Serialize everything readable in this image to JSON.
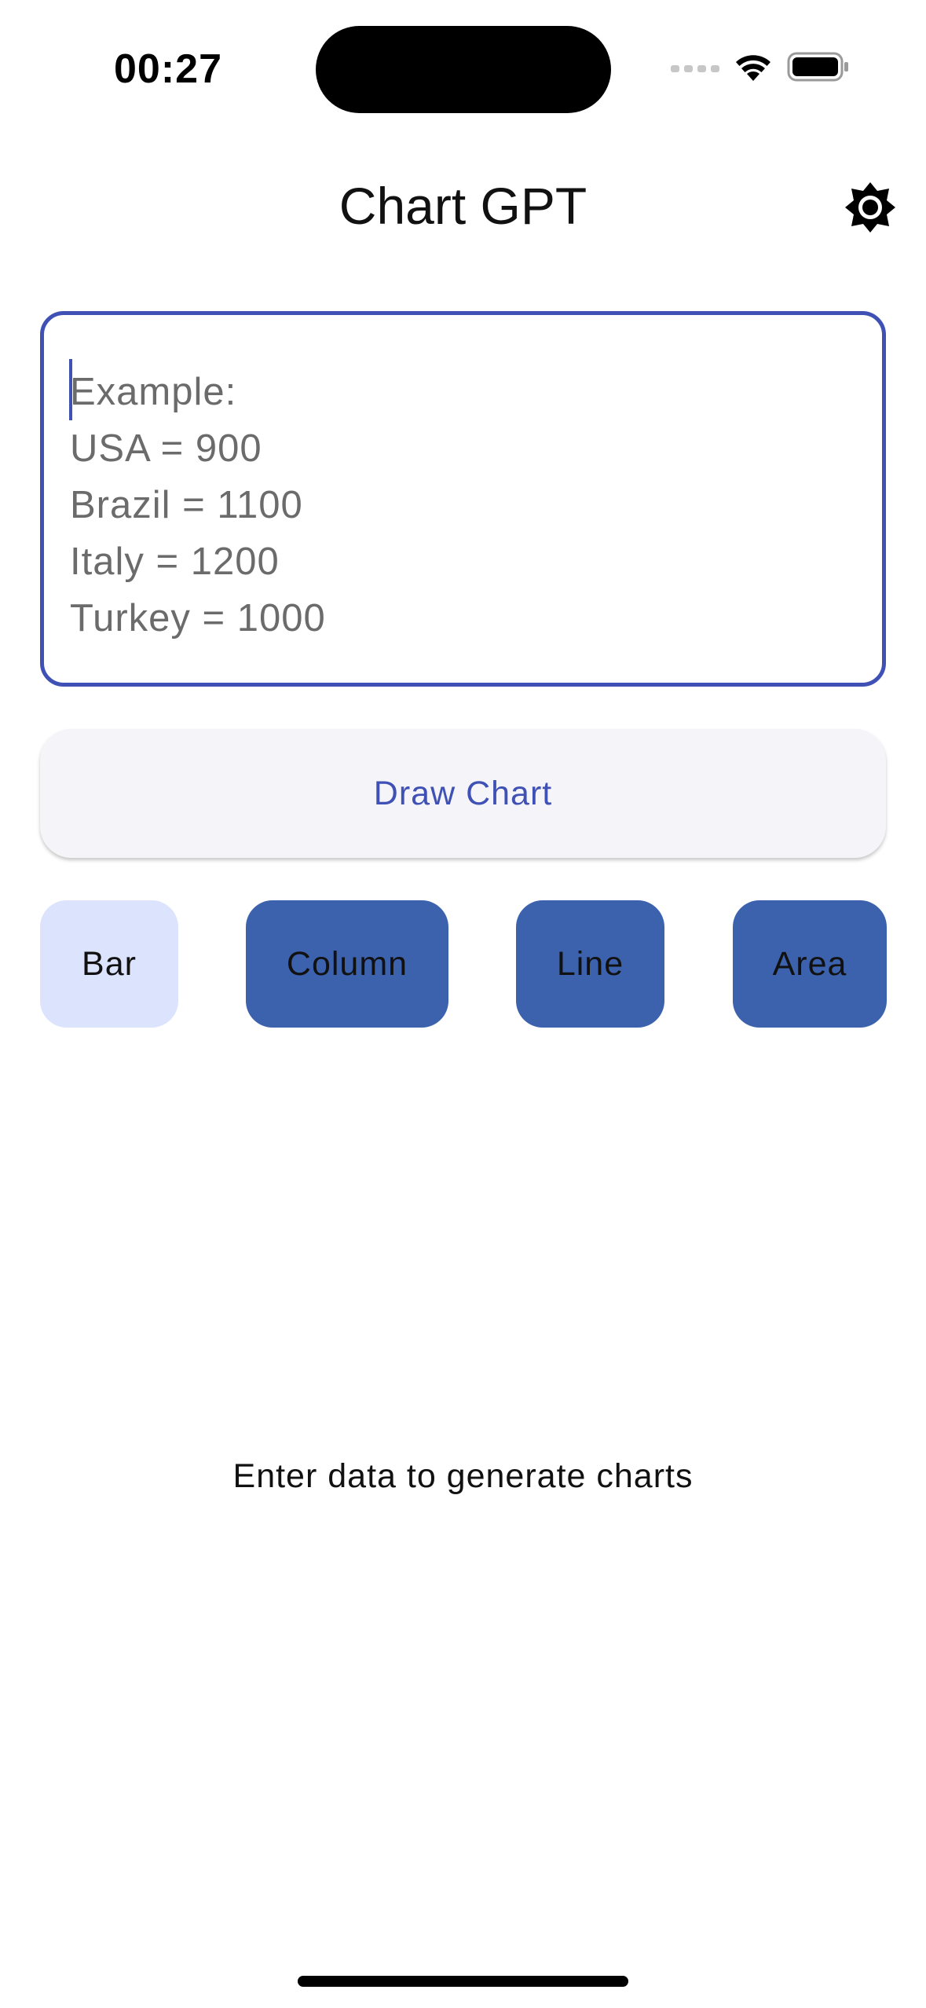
{
  "status_bar": {
    "time": "00:27",
    "icons": [
      "cellular-signal-icon",
      "wifi-icon",
      "battery-icon"
    ]
  },
  "header": {
    "title": "Chart GPT",
    "theme_icon": "brightness-icon"
  },
  "data_input": {
    "value": "",
    "placeholder": "Example:\nUSA = 900\nBrazil = 1100\nItaly = 1200\nTurkey = 1000"
  },
  "draw_button": {
    "label": "Draw Chart"
  },
  "chart_types": [
    {
      "label": "Bar",
      "selected": true
    },
    {
      "label": "Column",
      "selected": false
    },
    {
      "label": "Line",
      "selected": false
    },
    {
      "label": "Area",
      "selected": false
    }
  ],
  "empty_state": {
    "message": "Enter data to generate charts"
  },
  "colors": {
    "accent": "#3f51b5",
    "chip_selected_bg": "#dbe3fd",
    "chip_unselected_bg": "#3c62ae",
    "button_bg": "#f4f4f9",
    "placeholder_text": "#6b6b6b"
  }
}
